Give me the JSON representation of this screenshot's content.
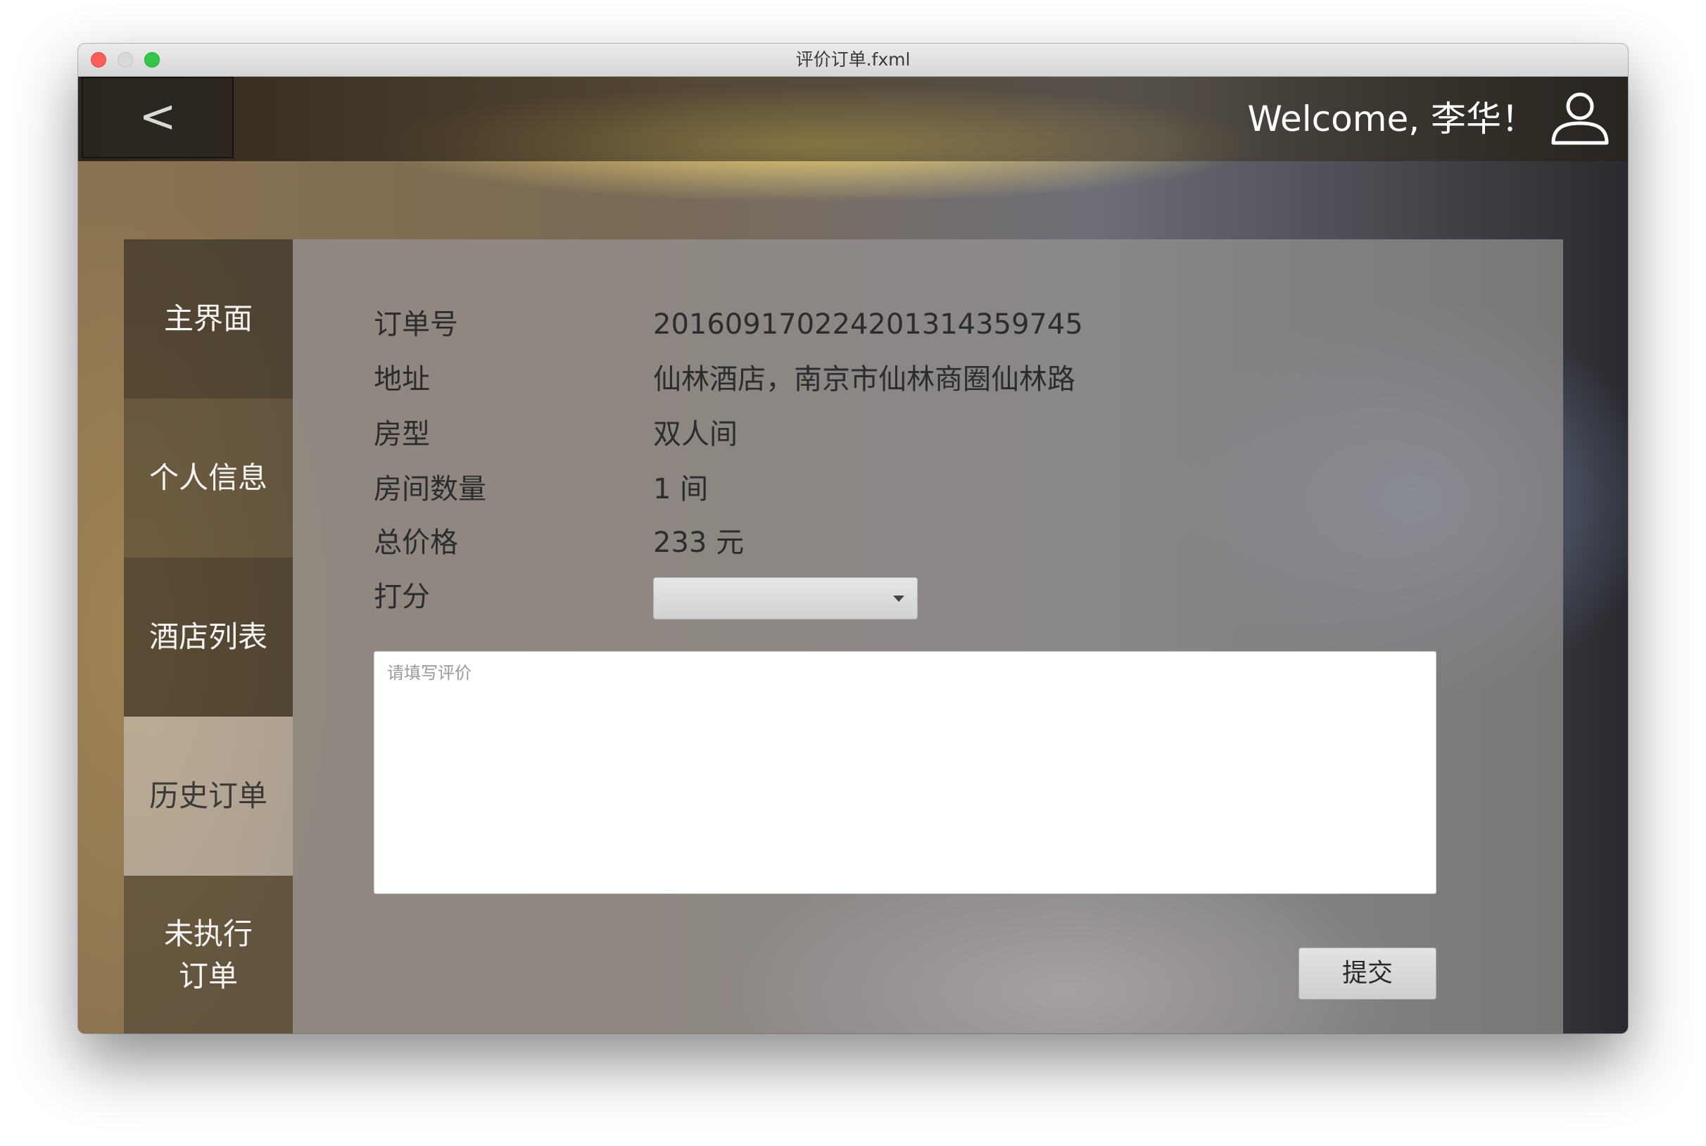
{
  "window": {
    "title": "评价订单.fxml"
  },
  "header": {
    "back_label": "<",
    "welcome_text": "Welcome, 李华！",
    "user_icon": "user-outline-icon"
  },
  "sidebar": {
    "items": [
      {
        "label": "主界面",
        "active": false
      },
      {
        "label": "个人信息",
        "active": false
      },
      {
        "label": "酒店列表",
        "active": false
      },
      {
        "label": "历史订单",
        "active": true
      },
      {
        "label": "未执行\n订单",
        "active": false
      }
    ]
  },
  "order": {
    "order_no": {
      "label": "订单号",
      "value": "2016091702242013143597​45"
    },
    "address": {
      "label": "地址",
      "value": "仙林酒店，南京市仙林商圈仙林路"
    },
    "room_type": {
      "label": "房型",
      "value": "双人间"
    },
    "room_count": {
      "label": "房间数量",
      "value": "1 间"
    },
    "total_price": {
      "label": "总价格",
      "value": "233 元"
    },
    "rating": {
      "label": "打分",
      "value": ""
    }
  },
  "review": {
    "placeholder": "请填写评价",
    "value": ""
  },
  "submit_label": "提交",
  "colors": {
    "active_nav": "#c8c8cc",
    "panel": "#969191",
    "accent_header": "#2d281e"
  }
}
